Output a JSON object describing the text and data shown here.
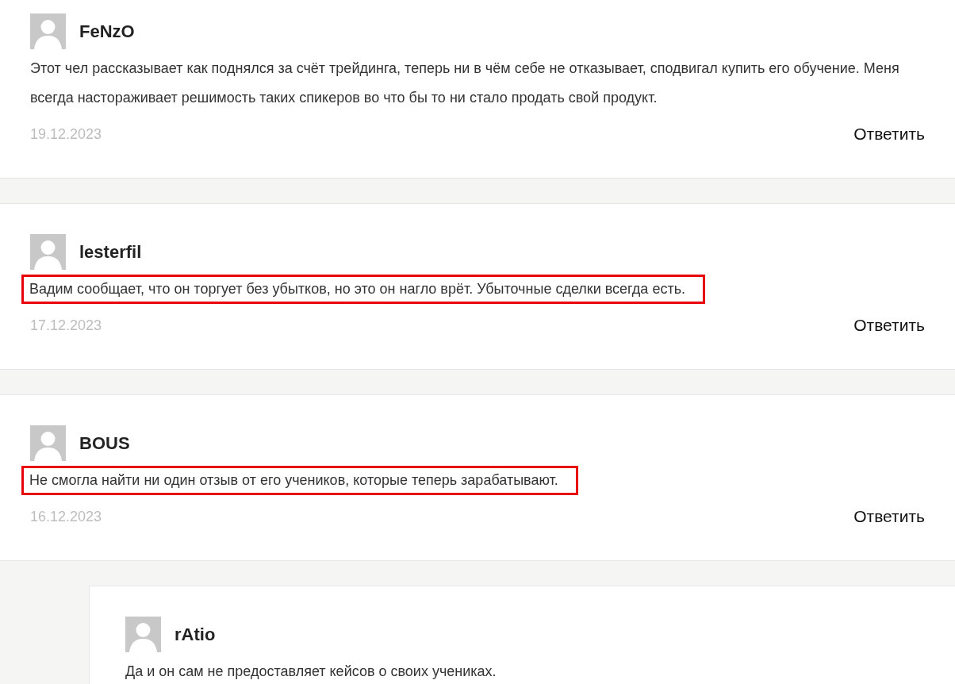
{
  "comments": [
    {
      "author": "FeNzO",
      "text": "Этот чел рассказывает как поднялся за счёт трейдинга, теперь ни в чём себе не отказывает, сподвигал купить его обучение. Меня всегда настораживает решимость таких спикеров во что бы то ни стало продать свой продукт.",
      "highlighted": false,
      "date": "19.12.2023",
      "reply": "Ответить"
    },
    {
      "author": "lesterfil",
      "text": "Вадим сообщает, что он торгует без убытков, но это он нагло врёт. Убыточные сделки всегда есть.",
      "highlighted": true,
      "date": "17.12.2023",
      "reply": "Ответить"
    },
    {
      "author": "BOUS",
      "text": "Не смогла найти ни один отзыв от его учеников, которые теперь зарабатывают.",
      "highlighted": true,
      "date": "16.12.2023",
      "reply": "Ответить",
      "children": [
        {
          "author": "rAtio",
          "text": "Да и он сам не предоставляет кейсов о своих учениках.",
          "highlighted": false
        }
      ]
    }
  ]
}
